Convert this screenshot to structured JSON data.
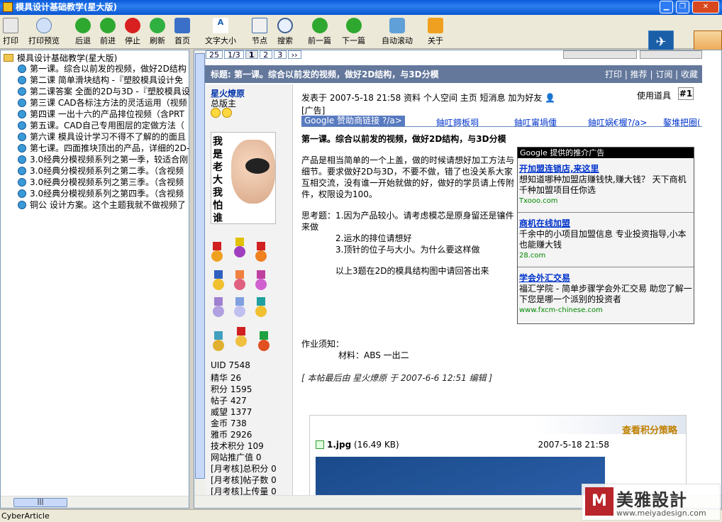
{
  "window": {
    "title": "模具设计基础教学(星大版)"
  },
  "toolbar": {
    "items": [
      {
        "label": "打印",
        "icon": "printer-icon"
      },
      {
        "label": "打印预览",
        "icon": "print-preview-icon"
      },
      {
        "label": "后退",
        "icon": "back-icon"
      },
      {
        "label": "前进",
        "icon": "forward-icon"
      },
      {
        "label": "停止",
        "icon": "stop-icon"
      },
      {
        "label": "刷新",
        "icon": "refresh-icon"
      },
      {
        "label": "首页",
        "icon": "home-icon"
      },
      {
        "label": "文字大小",
        "icon": "font-size-icon"
      },
      {
        "label": "节点",
        "icon": "node-icon"
      },
      {
        "label": "搜索",
        "icon": "search-icon"
      },
      {
        "label": "前一篇",
        "icon": "prev-article-icon"
      },
      {
        "label": "下一篇",
        "icon": "next-article-icon"
      },
      {
        "label": "自动滚动",
        "icon": "auto-scroll-icon"
      },
      {
        "label": "关于",
        "icon": "about-icon"
      }
    ]
  },
  "tree": {
    "root": "模具设计基础教学(星大版)",
    "items": [
      "第一课。综合以前发的视频，做好2D结构",
      "第二课 简单滑块结构 -『塑胶模具设计免",
      "第二课答案 全面的2D与3D -『塑胶模具设",
      "第三课 CAD各标注方法的灵活运用（视频",
      "第四课 一出十六的产品排位视频（含PRT",
      "第五课。CAD自己专用图层的定做方法（",
      "第六课 模具设计学习不得不了解的的面且",
      "第七课。四面推块顶出的产品，详细的2D-",
      "3.0经典分模视频系列之第一季，较适合刚",
      "3.0经典分模视频系列之第二季。（含视频",
      "3.0经典分模视频系列之第三季。（含视频",
      "3.0经典分模视频系列之第四季。（含视频",
      "铜公 设计方案。这个主题我就不做视频了"
    ]
  },
  "pager": {
    "total": "25",
    "pos": "1/3",
    "pages": [
      "1",
      "2",
      "3"
    ],
    "next": "››"
  },
  "post": {
    "title": "标题: 第一课。综合以前发的视频，做好2D结构，与3D分模",
    "actions": "打印 | 推荐 | 订阅 | 收藏",
    "meta": "发表于  2007-5-18 21:58  资料  个人空间  主页  短消息  加为好友",
    "tools": "使用道具",
    "floor": "#1",
    "ad_label": "[广告]",
    "ad_bar": {
      "google": "Google 赞助商链接 ?/a>",
      "links": [
        "鈾叿鍗板埛",
        "鈾叿甯堝偅",
        "鈾叿娲€楃?/a>",
        "鏊堆把圈("
      ]
    },
    "heading": "第一课。综合以前发的视频，做好2D结构，与3D分模",
    "body": "产品是相当简单的一个上盖，做的时候请想好加工方法与细节。要求做好2D与3D，不要不做，错了也没关系大家互相交流，没有谁一开始就做的好，做好的学员请上传附件，权限设为100。",
    "questions": {
      "intro": "思考题：1.因为产品较小。请考虑模芯是原身留还是镶件来做",
      "q2": "2.运水的排位请想好",
      "q3": "3.顶针的位子与大小。为什么要这样做",
      "tail": "以上3题在2D的模具结构图中请回答出来"
    },
    "notice_title": "作业须知：",
    "notice_body": "材料：ABS     一出二",
    "edit_note": "[ 本帖最后由 星火燎原 于 2007-6-6 12:51 编辑 ]"
  },
  "author": {
    "nick": "星火燎原",
    "rank": "总版主",
    "avatar_text": "我是老大  我怕谁",
    "stats": [
      "UID 7548",
      "精华 26",
      "积分 1595",
      "帖子 427",
      "威望 1377",
      "金币 738",
      "雅币 2926",
      "技术积分 109",
      "网站推广值 0",
      "[月考核]总积分 0",
      "[月考核]帖子数 0",
      "[月考核]上传量 0"
    ]
  },
  "google_ads": {
    "header": "Google 提供的推介广告",
    "ads": [
      {
        "title": "开加盟连锁店,来这里",
        "desc": "想知道哪种加盟店赚钱快,赚大钱？ 天下商机千种加盟项目任你选",
        "url": "Txooo.com"
      },
      {
        "title": "商机在线加盟",
        "desc": "千余中的小项目加盟信息  专业投资指导,小本也能赚大钱",
        "url": "28.com"
      },
      {
        "title": "学会外汇交易",
        "desc": "福汇学院 - 简单步骤学会外汇交易  助您了解一下您是哪一个派别的投资者",
        "url": "www.fxcm-chinese.com"
      }
    ]
  },
  "attachment": {
    "score_link": "查看积分策略",
    "filename": "1.jpg",
    "size": "(16.49 KB)",
    "date": "2007-5-18 21:58"
  },
  "status": {
    "text": "CyberArticle"
  },
  "watermark": {
    "name": "美雅設計",
    "url": "www.meiyadesign.com"
  }
}
